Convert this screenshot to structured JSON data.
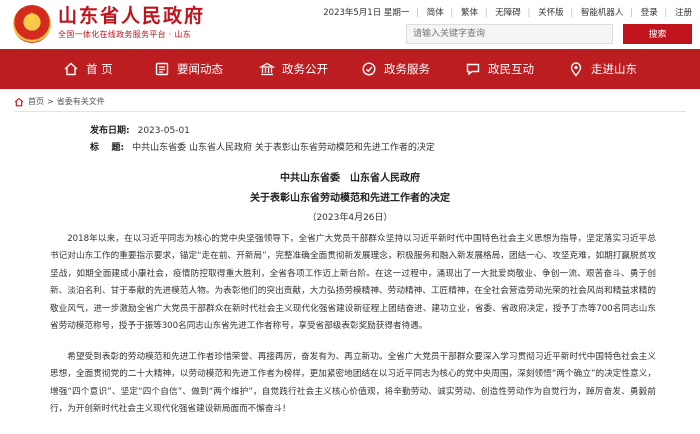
{
  "header": {
    "site_title": "山东省人民政府",
    "site_subtitle": "全国一体化在线政务服务平台 · 山东",
    "date_label": "2023年5月1日 星期一",
    "links": [
      "简体",
      "繁体",
      "无障碍",
      "关怀版",
      "智能机器人",
      "登录",
      "注册"
    ],
    "search_placeholder": "请输入关键字查询",
    "search_button": "搜索"
  },
  "nav": {
    "items": [
      {
        "label": "首 页",
        "icon": "home-icon"
      },
      {
        "label": "要闻动态",
        "icon": "news-icon"
      },
      {
        "label": "政务公开",
        "icon": "open-government-icon"
      },
      {
        "label": "政务服务",
        "icon": "service-icon"
      },
      {
        "label": "政民互动",
        "icon": "interaction-icon"
      },
      {
        "label": "走进山东",
        "icon": "location-icon"
      }
    ]
  },
  "breadcrumb": {
    "home": "首页",
    "separator": ">",
    "current": "省委有关文件"
  },
  "meta": {
    "date_label": "发布日期:",
    "date_value": "2023-05-01",
    "title_label": "标    题:",
    "title_value": "中共山东省委 山东省人民政府 关于表彰山东省劳动模范和先进工作者的决定"
  },
  "document": {
    "issuer": "中共山东省委　山东省人民政府",
    "title": "关于表彰山东省劳动模范和先进工作者的决定",
    "date": "（2023年4月26日）",
    "paragraphs": [
      "2018年以来，在以习近平同志为核心的党中央坚强领导下，全省广大党员干部群众坚持以习近平新时代中国特色社会主义思想为指导，坚定落实习近平总书记对山东工作的重要指示要求，锚定“走在前、开新局”，完整准确全面贯彻新发展理念，积极服务和融入新发展格局，团结一心、攻坚克难，如期打赢脱贫攻坚战，如期全面建成小康社会，疫情防控取得重大胜利，全省各项工作迈上新台阶。在这一过程中，涌现出了一大批爱岗敬业、争创一流、艰苦奋斗、勇于创新、淡泊名利、甘于奉献的先进模范人物。为表彰他们的突出贡献，大力弘扬劳模精神、劳动精神、工匠精神，在全社会营造劳动光荣的社会风尚和精益求精的敬业风气，进一步激励全省广大党员干部群众在新时代社会主义现代化强省建设新征程上团结奋进、建功立业，省委、省政府决定，授予丁杰等700名同志山东省劳动模范称号，授予于振等300名同志山东省先进工作者称号，享受省部级表彰奖励获得者待遇。",
      "希望受到表彰的劳动模范和先进工作者珍惜荣誉、再接再厉，奋发有为、再立新功。全省广大党员干部群众要深入学习贯彻习近平新时代中国特色社会主义思想，全面贯彻党的二十大精神，以劳动模范和先进工作者为榜样，更加紧密地团结在以习近平同志为核心的党中央周围，深刻领悟“两个确立”的决定性意义，增强“四个意识”、坚定“四个自信”、做到“两个维护”，自觉践行社会主义核心价值观，将辛勤劳动、诚实劳动、创造性劳动作为自觉行为，踔厉奋发、勇毅前行，为开创新时代社会主义现代化强省建设新局面而不懈奋斗！"
    ]
  },
  "colors": {
    "brand_red": "#c0131b",
    "nav_red": "#bb1d21"
  }
}
